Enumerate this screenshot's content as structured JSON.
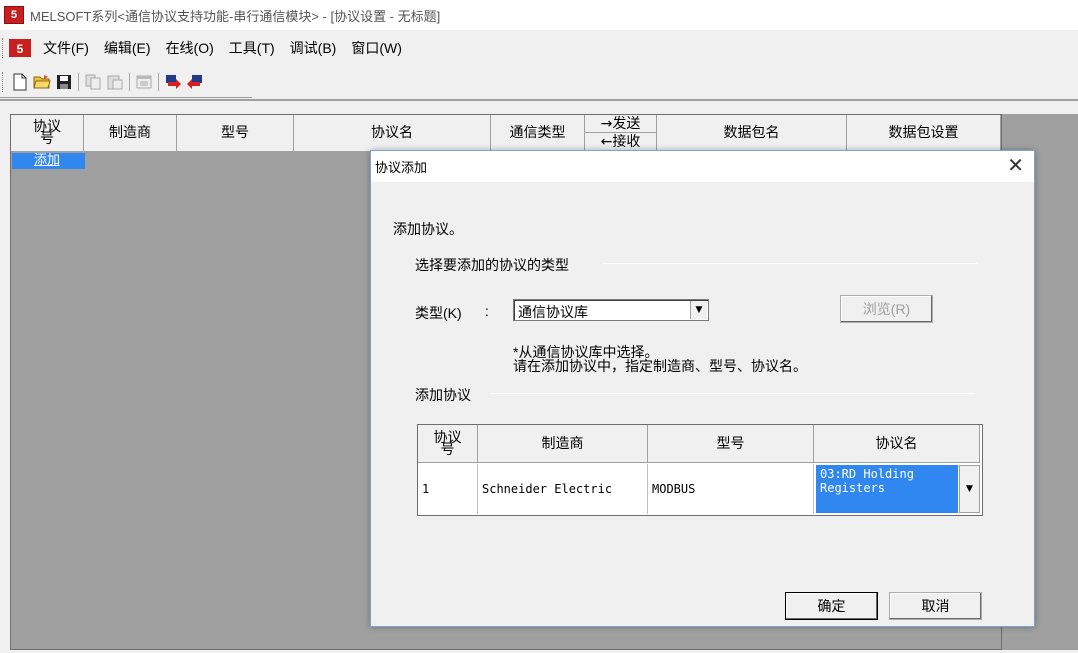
{
  "window": {
    "logo_text": "5",
    "title": "MELSOFT系列<通信协议支持功能-串行通信模块> - [协议设置 - 无标题]"
  },
  "menu": {
    "items": [
      "文件(F)",
      "编辑(E)",
      "在线(O)",
      "工具(T)",
      "调试(B)",
      "窗口(W)"
    ]
  },
  "toolbar": {
    "icons": [
      "new-file-icon",
      "open-folder-icon",
      "save-icon",
      "copy-icon",
      "paste-icon",
      "window-icon",
      "write-icon",
      "read-icon"
    ]
  },
  "grid": {
    "headers": {
      "no": "协议号",
      "maker": "制造商",
      "model": "型号",
      "protocol": "协议名",
      "comm_type": "通信类型",
      "send": "→发送",
      "recv": "←接收",
      "packet_name": "数据包名",
      "packet_setting": "数据包设置"
    },
    "add_row_label": "添加"
  },
  "dialog": {
    "title": "协议添加",
    "close": "✕",
    "heading": "添加协议。",
    "group1": "选择要添加的协议的类型",
    "type_label": "类型(K)",
    "type_colon": ":",
    "type_value": "通信协议库",
    "browse_button": "浏览(R)",
    "hint_line1": "*从通信协议库中选择。",
    "hint_line2": "请在添加协议中，指定制造商、型号、协议名。",
    "group2": "添加协议",
    "table": {
      "headers": {
        "no": "协议号",
        "maker": "制造商",
        "model": "型号",
        "protocol": "协议名"
      },
      "row": {
        "no": "1",
        "maker": "Schneider Electric",
        "model": "MODBUS",
        "protocol": "03:RD Holding Registers"
      }
    },
    "ok_button": "确定",
    "cancel_button": "取消"
  }
}
